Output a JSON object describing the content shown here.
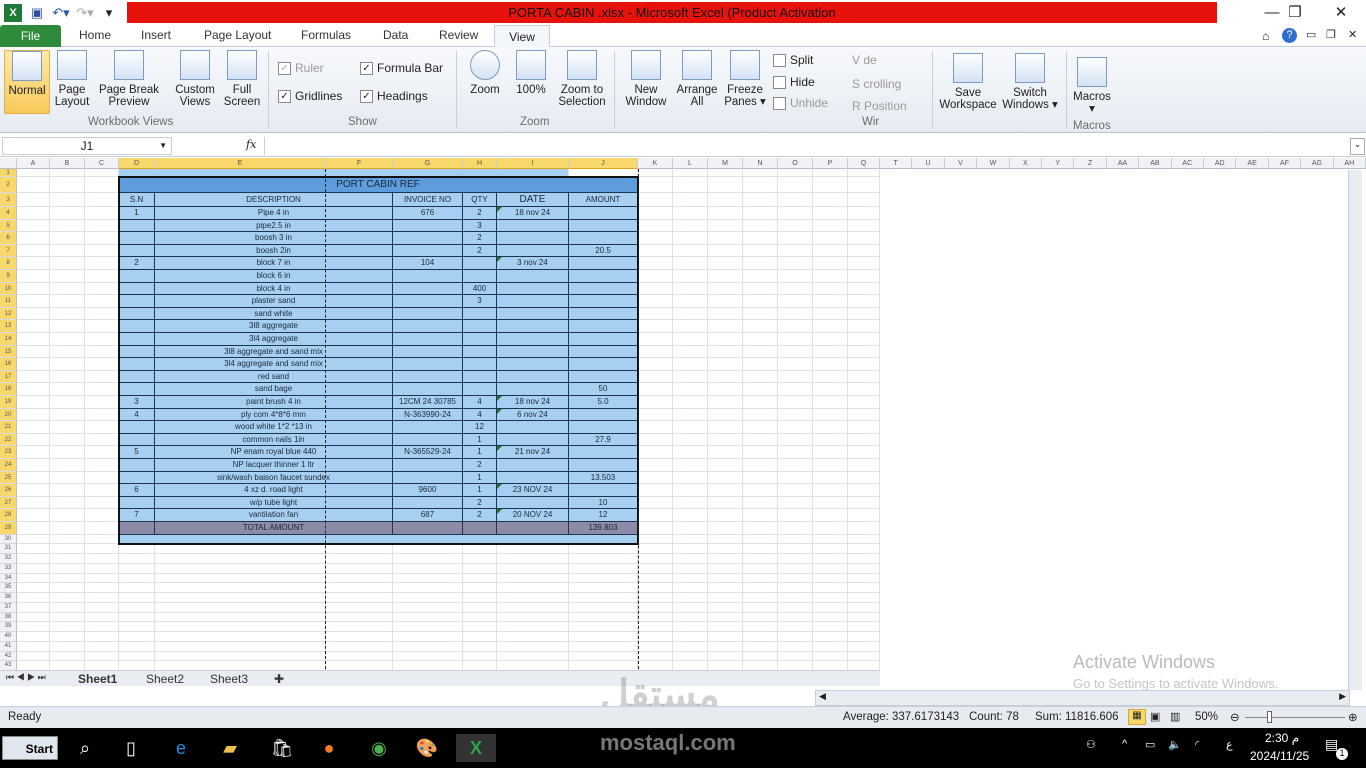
{
  "window": {
    "title": "PORTA CABIN .xlsx  -  Microsoft Excel (Product Activation",
    "minimize": "—",
    "restore": "❐",
    "close": "✕"
  },
  "tabs": [
    "File",
    "Home",
    "Insert",
    "Page Layout",
    "Formulas",
    "Data",
    "Review",
    "View"
  ],
  "active_tab": "View",
  "ribbon": {
    "workbook_views": {
      "label": "Workbook Views",
      "buttons": [
        "Normal",
        "Page\nLayout",
        "Page Break\nPreview",
        "Custom\nViews",
        "Full\nScreen"
      ]
    },
    "show": {
      "label": "Show",
      "ruler": "Ruler",
      "formula_bar": "Formula Bar",
      "gridlines": "Gridlines",
      "headings": "Headings"
    },
    "zoom": {
      "label": "Zoom",
      "buttons": [
        "Zoom",
        "100%",
        "Zoom to\nSelection"
      ]
    },
    "window": {
      "label": "Wir",
      "buttons": [
        "New\nWindow",
        "Arrange\nAll",
        "Freeze\nPanes ▾"
      ],
      "split": "Split",
      "hide": "Hide",
      "unhide": "Unhide",
      "view_side": "V  de",
      "sync_scroll": "S  crolling",
      "reset_pos": "R  Position",
      "save_workspace": "Save\nWorkspace",
      "switch_windows": "Switch\nWindows ▾"
    },
    "macros": {
      "label": "Macros",
      "button": "Macros\n▾"
    }
  },
  "formula_bar": {
    "name_box": "J1",
    "fx": "fx",
    "value": ""
  },
  "columns": [
    "A",
    "B",
    "C",
    "D",
    "E",
    "F",
    "G",
    "H",
    "I",
    "J",
    "K",
    "L",
    "M",
    "N",
    "O",
    "P",
    "Q"
  ],
  "right_columns": [
    "T",
    "U",
    "V",
    "W",
    "X",
    "Y",
    "Z",
    "AA",
    "AB",
    "AC",
    "AD",
    "AE",
    "AF",
    "AG",
    "AH"
  ],
  "sheet": {
    "title": "PORT CABIN REF",
    "headers": [
      "S.N",
      "DESCRIPTION",
      "INVOICE NO",
      "QTY",
      "DATE",
      "AMOUNT"
    ],
    "rows": [
      [
        "1",
        "Pipe 4 in",
        "676",
        "2",
        "18 nov 24",
        ""
      ],
      [
        "",
        "pipe2.5 in",
        "",
        "3",
        "",
        ""
      ],
      [
        "",
        "boosh 3 in",
        "",
        "2",
        "",
        ""
      ],
      [
        "",
        "boosh 2in",
        "",
        "2",
        "",
        "20.5"
      ],
      [
        "2",
        "block 7 in",
        "104",
        "",
        "3 nov 24",
        ""
      ],
      [
        "",
        "block 6 in",
        "",
        "",
        "",
        ""
      ],
      [
        "",
        "block 4 in",
        "",
        "400",
        "",
        ""
      ],
      [
        "",
        "plaster sand",
        "",
        "3",
        "",
        ""
      ],
      [
        "",
        "sand white",
        "",
        "",
        "",
        ""
      ],
      [
        "",
        "3l8 aggregate",
        "",
        "",
        "",
        ""
      ],
      [
        "",
        "3l4 aggregate",
        "",
        "",
        "",
        ""
      ],
      [
        "",
        "3l8 aggregate and sand mix",
        "",
        "",
        "",
        ""
      ],
      [
        "",
        "3l4 aggregate and sand mix",
        "",
        "",
        "",
        ""
      ],
      [
        "",
        "red sand",
        "",
        "",
        "",
        ""
      ],
      [
        "",
        "sand bage",
        "",
        "",
        "",
        "50"
      ],
      [
        "3",
        "paint brush 4 in",
        "12CM 24 30785",
        "4",
        "18 nov 24",
        "5.0"
      ],
      [
        "4",
        "ply com 4*8*6 mm",
        "N-363990-24",
        "4",
        "6 nov 24",
        ""
      ],
      [
        "",
        "wood white 1*2 *13 in",
        "",
        "12",
        "",
        ""
      ],
      [
        "",
        "common nails 1in",
        "",
        "1",
        "",
        "27.9"
      ],
      [
        "5",
        "NP enam royal blue 440",
        "N-365529-24",
        "1",
        "21 nov 24",
        ""
      ],
      [
        "",
        "NP lacquer thinner 1 ltr",
        "",
        "2",
        "",
        ""
      ],
      [
        "",
        "sink/wash baison faucet sundex",
        "",
        "1",
        "",
        "13.503"
      ],
      [
        "6",
        "4 xz d. road light",
        "9600",
        "1",
        "23 NOV 24",
        ""
      ],
      [
        "",
        "w/p tube light",
        "",
        "2",
        "",
        "10"
      ],
      [
        "7",
        "vantilation fan",
        "687",
        "2",
        "20 NOV 24",
        "12"
      ]
    ],
    "total_label": "TOTAL AMOUNT",
    "total_value": "139.803"
  },
  "sheet_tabs": [
    "Sheet1",
    "Sheet2",
    "Sheet3"
  ],
  "active_sheet": "Sheet1",
  "status": {
    "ready": "Ready",
    "average": "Average: 337.6173143",
    "count": "Count: 78",
    "sum": "Sum: 11816.606",
    "zoom": "50%",
    "zoom_level_percent": 50
  },
  "activation": {
    "title": "Activate Windows",
    "subtitle": "Go to Settings to activate Windows."
  },
  "watermark": {
    "logo": "مستقل",
    "url": "mostaql.com"
  },
  "taskbar": {
    "start": "Start",
    "time": "2:30 م",
    "date": "2024/11/25",
    "lang": "ع",
    "notif": "1"
  },
  "colors": {
    "title_red": "#e8120c",
    "table_fill": "#a7cff2",
    "header_fill": "#5d9ddc",
    "total_fill": "#8e8ba8",
    "file_tab": "#2e8b3a"
  }
}
